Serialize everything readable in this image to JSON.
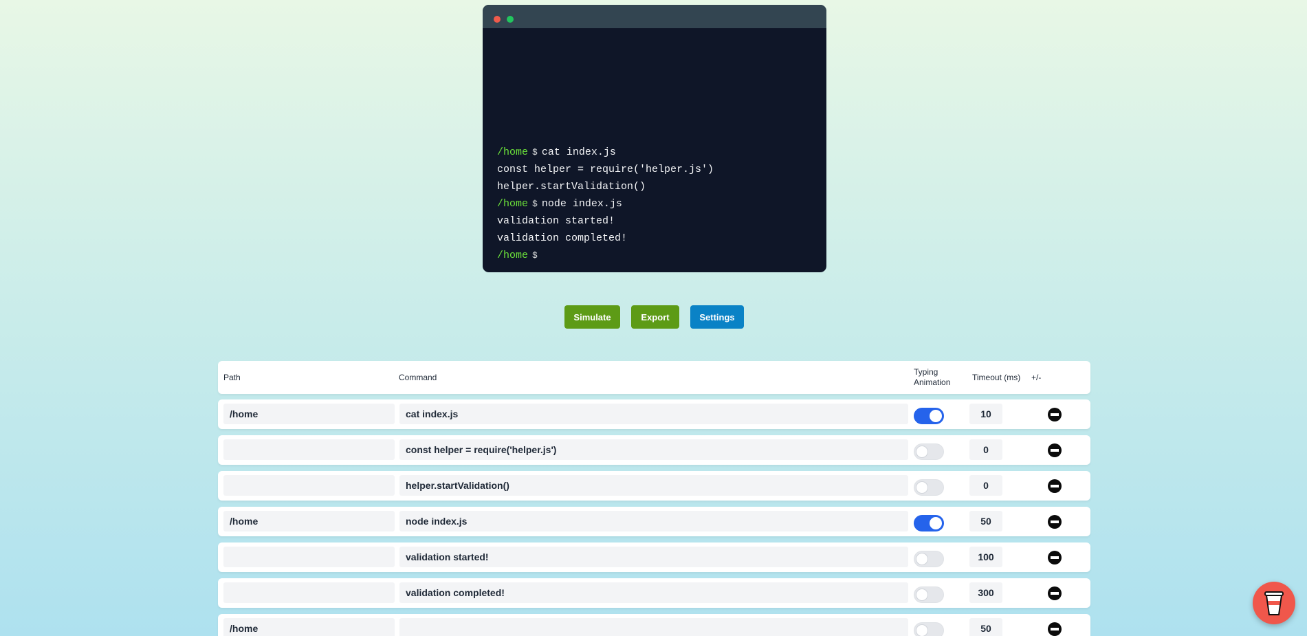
{
  "terminal": {
    "lines": [
      {
        "path": "/home",
        "dollar": "$",
        "text": "cat index.js"
      },
      {
        "path": "",
        "dollar": "",
        "text": "const helper = require('helper.js')"
      },
      {
        "path": "",
        "dollar": "",
        "text": "helper.startValidation()"
      },
      {
        "path": "/home",
        "dollar": "$",
        "text": "node index.js"
      },
      {
        "path": "",
        "dollar": "",
        "text": "validation started!"
      },
      {
        "path": "",
        "dollar": "",
        "text": "validation completed!"
      },
      {
        "path": "/home",
        "dollar": "$",
        "text": ""
      }
    ]
  },
  "buttons": {
    "simulate": "Simulate",
    "export": "Export",
    "settings": "Settings"
  },
  "table": {
    "headers": {
      "path": "Path",
      "command": "Command",
      "typing_line1": "Typing",
      "typing_line2": "Animation",
      "timeout": "Timeout (ms)",
      "add_remove": "+/-"
    },
    "rows": [
      {
        "path": "/home",
        "command": "cat index.js",
        "typing": true,
        "timeout": "10"
      },
      {
        "path": "",
        "command": "const helper = require('helper.js')",
        "typing": false,
        "timeout": "0"
      },
      {
        "path": "",
        "command": "helper.startValidation()",
        "typing": false,
        "timeout": "0"
      },
      {
        "path": "/home",
        "command": "node index.js",
        "typing": true,
        "timeout": "50"
      },
      {
        "path": "",
        "command": "validation started!",
        "typing": false,
        "timeout": "100"
      },
      {
        "path": "",
        "command": "validation completed!",
        "typing": false,
        "timeout": "300"
      },
      {
        "path": "/home",
        "command": "",
        "typing": false,
        "timeout": "50"
      }
    ]
  },
  "colors": {
    "simulate_button": "#5d9b16",
    "export_button": "#5d9b16",
    "settings_button": "#0a82c6",
    "toggle_on": "#2563eb",
    "prompt_path": "#6be13a"
  },
  "floating": {
    "icon": "coffee-cup-icon"
  }
}
